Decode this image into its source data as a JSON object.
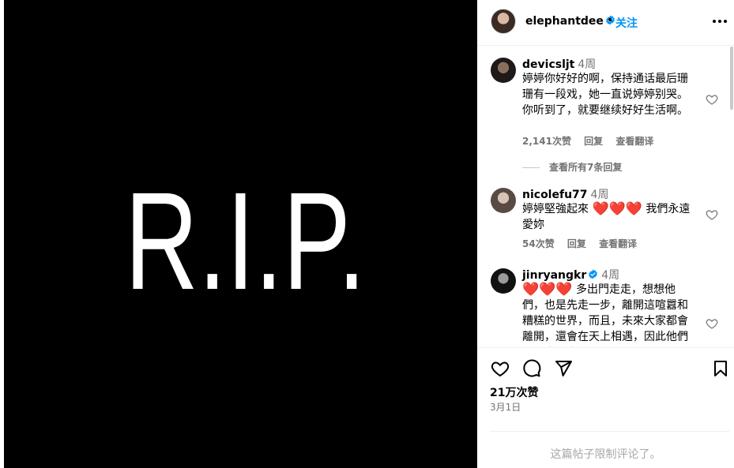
{
  "photo": {
    "text": "R.I.P.",
    "background": "#000000",
    "text_color": "#ffffff"
  },
  "post": {
    "username": "elephantdee",
    "verified": true,
    "dot": "•",
    "follow_label": "关注",
    "more_icon": "more-horizontal-icon"
  },
  "comments": [
    {
      "username": "devicsljt",
      "time": "4周",
      "text": "婷婷你好好的啊，保持通话最后珊珊有一段戏，她一直说婷婷别哭。你听到了，就要继续好好生活啊。",
      "likes": "2,141次赞",
      "reply": "回复",
      "translate": "查看翻译",
      "view_replies": "查看所有7条回复"
    },
    {
      "username": "nicolefu77",
      "time": "4周",
      "text_before": "婷婷堅強起來",
      "hearts": "❤️❤️❤️",
      "text_after": "我們永遠愛妳",
      "likes": "54次赞",
      "reply": "回复",
      "translate": "查看翻译"
    },
    {
      "username": "jinryangkr",
      "verified": true,
      "time": "4周",
      "hearts": "❤️❤️❤️",
      "text": "多出門走走，想想他們，也是先走一步，離開這喧囂和糟糕的世界，而且，未來大家都會離開，還會在天上相遇，因此他們先上去休息了，而我們在"
    }
  ],
  "actions": {
    "like_icon": "heart-icon",
    "comment_icon": "comment-icon",
    "share_icon": "send-icon",
    "save_icon": "bookmark-icon"
  },
  "likes_count": "21万次赞",
  "date": "3月1日",
  "comments_limited": "这篇帖子限制评论了。",
  "colors": {
    "accent": "#0095f6",
    "muted": "#737373",
    "heart": "#e02020"
  }
}
